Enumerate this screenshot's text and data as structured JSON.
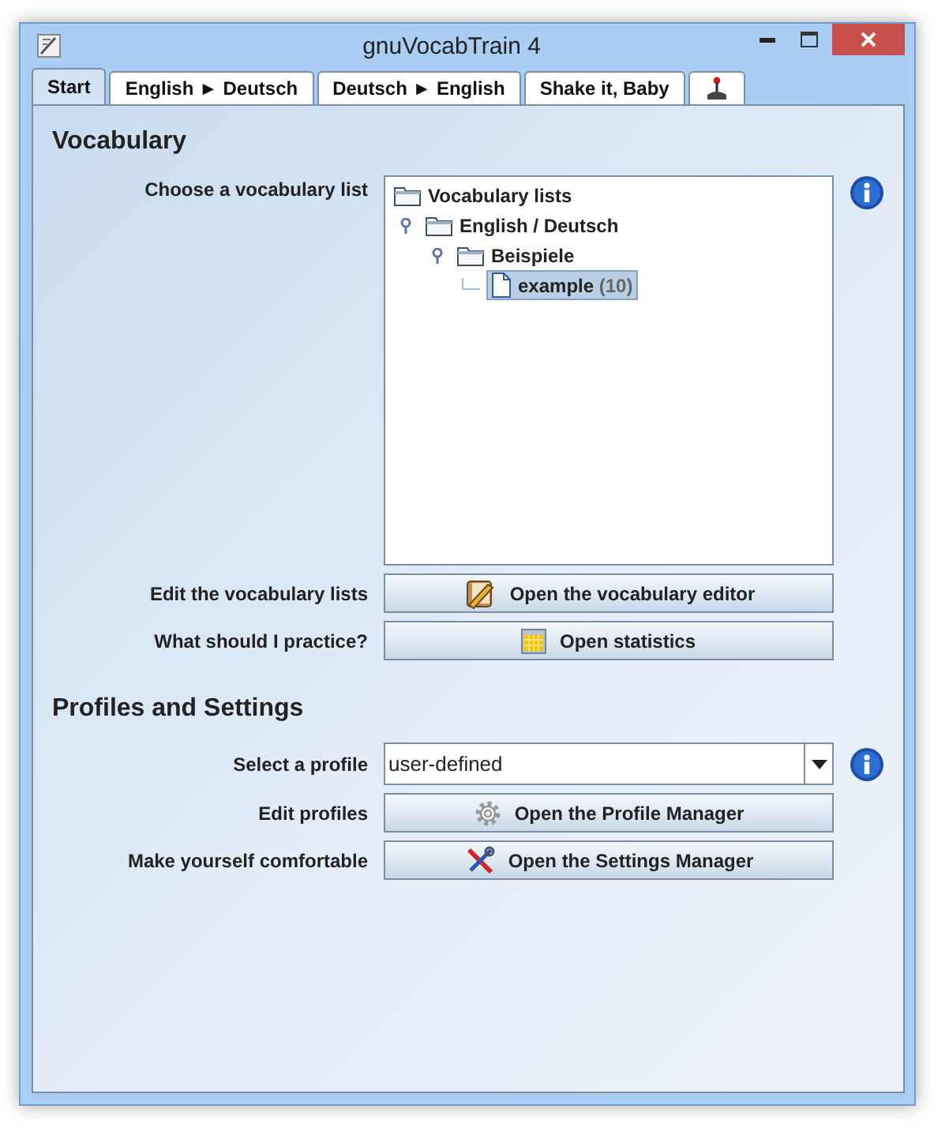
{
  "window": {
    "title": "gnuVocabTrain 4"
  },
  "tabs": [
    {
      "kind": "text",
      "label": "Start",
      "selected": true
    },
    {
      "kind": "text",
      "label": "English ► Deutsch",
      "selected": false
    },
    {
      "kind": "text",
      "label": "Deutsch ► English",
      "selected": false
    },
    {
      "kind": "text",
      "label": "Shake it, Baby",
      "selected": false
    },
    {
      "kind": "icon",
      "selected": false
    }
  ],
  "vocabulary": {
    "heading": "Vocabulary",
    "list_label": "Choose a vocabulary list",
    "tree": [
      {
        "label": "Vocabulary lists",
        "kind": "folder",
        "selected": false,
        "children": [
          {
            "label": "English / Deutsch",
            "kind": "folder",
            "expanded": true,
            "selected": false,
            "children": [
              {
                "label": "Beispiele",
                "kind": "folder",
                "expanded": true,
                "selected": false,
                "children": [
                  {
                    "label": "example",
                    "count": "(10)",
                    "kind": "file",
                    "selected": true
                  }
                ]
              }
            ]
          }
        ]
      }
    ],
    "actions": [
      {
        "label": "Edit the vocabulary lists",
        "button": "Open the vocabulary editor"
      },
      {
        "label": "What should I practice?",
        "button": "Open statistics"
      }
    ]
  },
  "profiles": {
    "heading": "Profiles and Settings",
    "select_label": "Select a profile",
    "select_value": "user-defined",
    "actions": [
      {
        "label": "Edit profiles",
        "button": "Open the Profile Manager"
      },
      {
        "label": "Make yourself comfortable",
        "button": "Open the Settings Manager"
      }
    ]
  }
}
